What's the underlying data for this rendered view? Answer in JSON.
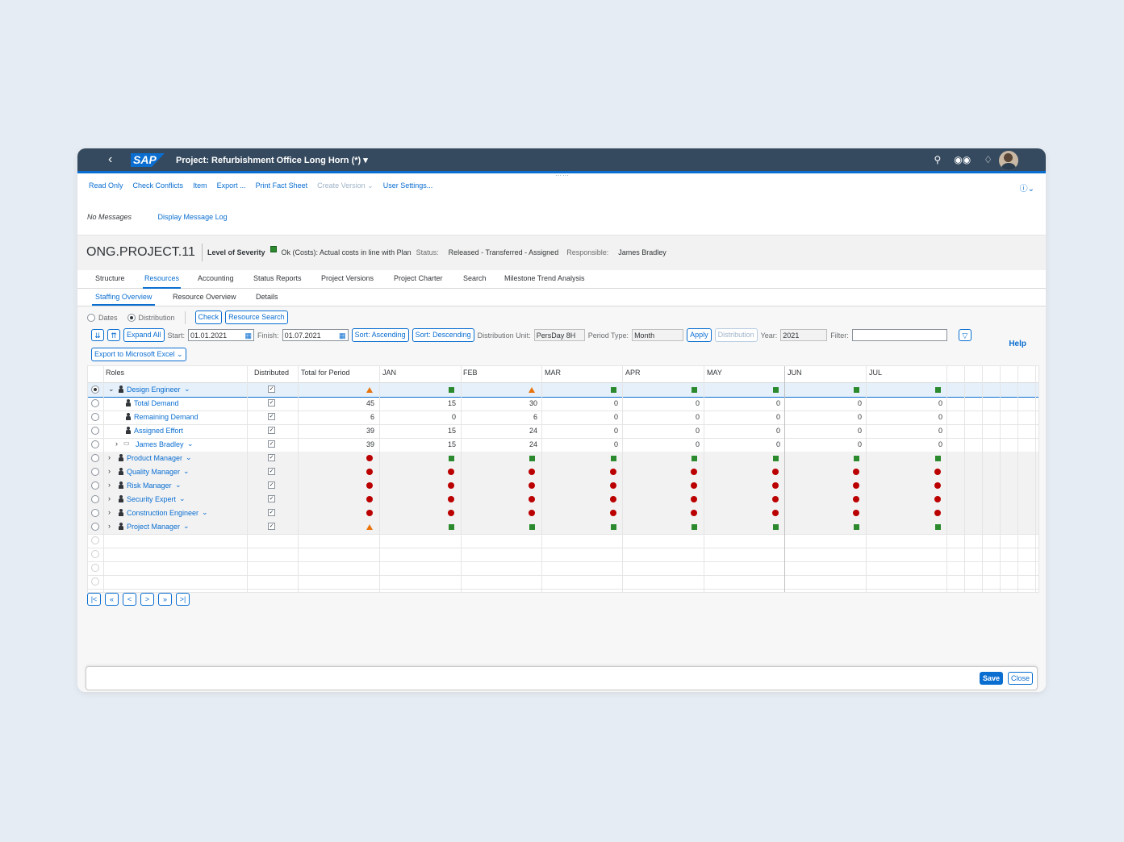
{
  "shell": {
    "logo": "SAP",
    "title": "Project: Refurbishment Office Long Horn (*)",
    "back": "‹"
  },
  "toolbar": {
    "items": [
      "Read Only",
      "Check Conflicts",
      "Item",
      "Export ...",
      "Print Fact Sheet",
      "Create Version",
      "User Settings..."
    ],
    "disabled_item": "Create Version"
  },
  "messages": {
    "status": "No Messages",
    "log_link": "Display Message Log"
  },
  "header": {
    "project_id": "ONG.PROJECT.11",
    "severity_label": "Level of Severity",
    "severity_text": "Ok (Costs): Actual costs in line with Plan",
    "status_label": "Status:",
    "status_value": "Released - Transferred - Assigned",
    "responsible_label": "Responsible:",
    "responsible_value": "James Bradley"
  },
  "tabs": [
    "Structure",
    "Resources",
    "Accounting",
    "Status Reports",
    "Project Versions",
    "Project Charter",
    "Search",
    "Milestone Trend Analysis"
  ],
  "subtabs": [
    "Staffing Overview",
    "Resource Overview",
    "Details"
  ],
  "controls": {
    "radio_dates": "Dates",
    "radio_distribution": "Distribution",
    "check_btn": "Check",
    "resource_search_btn": "Resource Search",
    "expand_all": "Expand All",
    "start_label": "Start:",
    "start_value": "01.01.2021",
    "finish_label": "Finish:",
    "finish_value": "01.07.2021",
    "sort_asc": "Sort: Ascending",
    "sort_desc": "Sort: Descending",
    "dist_unit_label": "Distribution Unit:",
    "dist_unit_value": "PersDay 8H",
    "period_type_label": "Period Type:",
    "period_type_value": "Month",
    "apply": "Apply",
    "distribution_btn": "Distribution",
    "year_label": "Year:",
    "year_value": "2021",
    "filter_label": "Filter:",
    "filter_value": "",
    "export_excel": "Export to Microsoft Excel",
    "help": "Help"
  },
  "grid": {
    "headers": [
      "Roles",
      "Distributed",
      "Total for Period",
      "JAN",
      "FEB",
      "MAR",
      "APR",
      "MAY",
      "JUN",
      "JUL"
    ],
    "rows": [
      {
        "label": "Design Engineer",
        "type": "role-open",
        "status": [
          "tri",
          "sq",
          "tri",
          "sq",
          "sq",
          "sq",
          "sq",
          "sq"
        ]
      },
      {
        "label": "Total Demand",
        "type": "child",
        "values": [
          "45",
          "15",
          "30",
          "0",
          "0",
          "0",
          "0",
          "0"
        ]
      },
      {
        "label": "Remaining Demand",
        "type": "child",
        "values": [
          "6",
          "0",
          "6",
          "0",
          "0",
          "0",
          "0",
          "0"
        ]
      },
      {
        "label": "Assigned Effort",
        "type": "child",
        "values": [
          "39",
          "15",
          "24",
          "0",
          "0",
          "0",
          "0",
          "0"
        ]
      },
      {
        "label": "James Bradley",
        "type": "person",
        "values": [
          "39",
          "15",
          "24",
          "0",
          "0",
          "0",
          "0",
          "0"
        ]
      },
      {
        "label": "Product Manager",
        "type": "role",
        "status": [
          "dot",
          "sq",
          "sq",
          "sq",
          "sq",
          "sq",
          "sq",
          "sq"
        ]
      },
      {
        "label": "Quality Manager",
        "type": "role",
        "status": [
          "dot",
          "dot",
          "dot",
          "dot",
          "dot",
          "dot",
          "dot",
          "dot"
        ]
      },
      {
        "label": "Risk Manager",
        "type": "role",
        "status": [
          "dot",
          "dot",
          "dot",
          "dot",
          "dot",
          "dot",
          "dot",
          "dot"
        ]
      },
      {
        "label": "Security Expert",
        "type": "role",
        "status": [
          "dot",
          "dot",
          "dot",
          "dot",
          "dot",
          "dot",
          "dot",
          "dot"
        ]
      },
      {
        "label": "Construction Engineer",
        "type": "role",
        "status": [
          "dot",
          "dot",
          "dot",
          "dot",
          "dot",
          "dot",
          "dot",
          "dot"
        ]
      },
      {
        "label": "Project Manager",
        "type": "role",
        "status": [
          "tri",
          "sq",
          "sq",
          "sq",
          "sq",
          "sq",
          "sq",
          "sq"
        ]
      }
    ]
  },
  "status_colors": {
    "sq": "#2b8a2e",
    "dot": "#bb0000",
    "tri": "#e9730c"
  },
  "footer": {
    "save": "Save",
    "close": "Close"
  }
}
